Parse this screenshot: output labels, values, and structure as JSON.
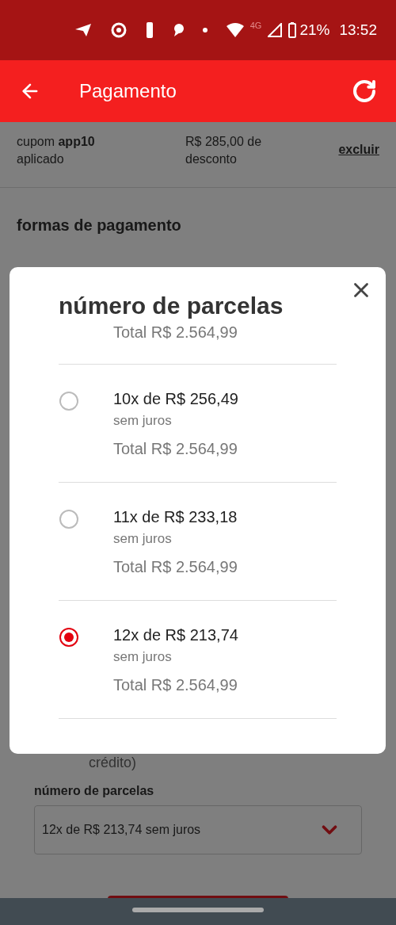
{
  "status_bar": {
    "network": "4G",
    "battery": "21%",
    "time": "13:52"
  },
  "app_bar": {
    "title": "Pagamento"
  },
  "background": {
    "coupon": "cupom **app10** aplicado",
    "discount": "R$ 285,00 de desconto",
    "remove_link": "excluir",
    "section_title": "formas de pagamento",
    "card_note": "crédito)",
    "installments_label": "número de parcelas",
    "installments_value": "12x de R$ 213,74 sem juros"
  },
  "dialog": {
    "title": "número de parcelas",
    "total": "Total R$ 2.564,99",
    "options": [
      {
        "label": "10x de R$ 256,49",
        "note": "sem juros",
        "total": "Total R$ 2.564,99",
        "selected": false
      },
      {
        "label": "11x de R$ 233,18",
        "note": "sem juros",
        "total": "Total R$ 2.564,99",
        "selected": false
      },
      {
        "label": "12x de R$ 213,74",
        "note": "sem juros",
        "total": "Total R$ 2.564,99",
        "selected": true
      }
    ]
  }
}
